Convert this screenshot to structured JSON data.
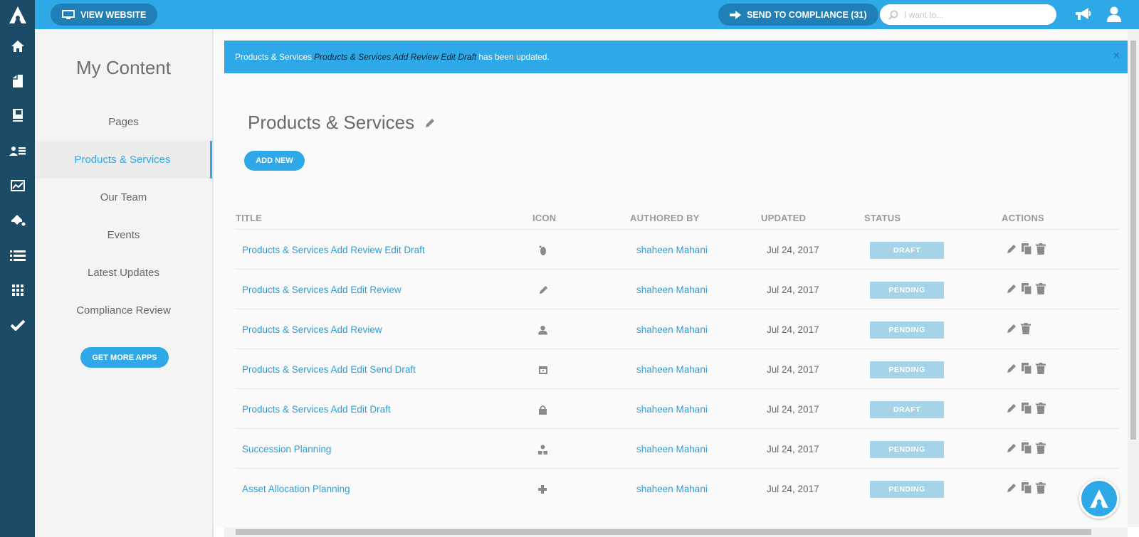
{
  "topbar": {
    "view_website": "VIEW WEBSITE",
    "send_to_compliance": "SEND TO COMPLIANCE (31)",
    "search_placeholder": "I want to..."
  },
  "rail": {
    "icons": [
      "home-icon",
      "pages-icon",
      "book-icon",
      "team-icon",
      "chart-icon",
      "paint-bucket-icon",
      "list-icon",
      "apps-grid-icon",
      "checkmark-icon"
    ]
  },
  "sidebar": {
    "title": "My Content",
    "items": [
      {
        "label": "Pages"
      },
      {
        "label": "Products & Services"
      },
      {
        "label": "Our Team"
      },
      {
        "label": "Events"
      },
      {
        "label": "Latest Updates"
      },
      {
        "label": "Compliance Review"
      }
    ],
    "get_more": "GET MORE APPS"
  },
  "alert": {
    "prefix": "Products & Services",
    "item": "Products & Services Add Review Edit Draft",
    "suffix": "has been updated.",
    "close": "×"
  },
  "main": {
    "title": "Products & Services",
    "add_new": "ADD NEW"
  },
  "table": {
    "headers": {
      "title": "TITLE",
      "icon": "ICON",
      "author": "AUTHORED BY",
      "updated": "UPDATED",
      "status": "STATUS",
      "actions": "ACTIONS"
    },
    "rows": [
      {
        "title": "Products & Services Add Review Edit Draft",
        "icon": "foot-icon",
        "author": "shaheen Mahani",
        "updated": "Jul 24, 2017",
        "status": "DRAFT",
        "copy": true
      },
      {
        "title": "Products & Services Add Edit Review",
        "icon": "pencil-icon",
        "author": "shaheen Mahani",
        "updated": "Jul 24, 2017",
        "status": "PENDING",
        "copy": true
      },
      {
        "title": "Products & Services Add Review",
        "icon": "person-icon",
        "author": "shaheen Mahani",
        "updated": "Jul 24, 2017",
        "status": "PENDING",
        "copy": false
      },
      {
        "title": "Products & Services Add Edit Send Draft",
        "icon": "calendar-icon",
        "author": "shaheen Mahani",
        "updated": "Jul 24, 2017",
        "status": "PENDING",
        "copy": true
      },
      {
        "title": "Products & Services Add Edit Draft",
        "icon": "lock-icon",
        "author": "shaheen Mahani",
        "updated": "Jul 24, 2017",
        "status": "DRAFT",
        "copy": true
      },
      {
        "title": "Succession Planning",
        "icon": "hierarchy-icon",
        "author": "shaheen Mahani",
        "updated": "Jul 24, 2017",
        "status": "PENDING",
        "copy": true
      },
      {
        "title": "Asset Allocation Planning",
        "icon": "plus-icon",
        "author": "shaheen Mahani",
        "updated": "Jul 24, 2017",
        "status": "PENDING",
        "copy": true
      }
    ]
  },
  "colors": {
    "accent": "#2ea8e6",
    "rail": "#1c4b68",
    "badge": "#a5d3ea"
  }
}
